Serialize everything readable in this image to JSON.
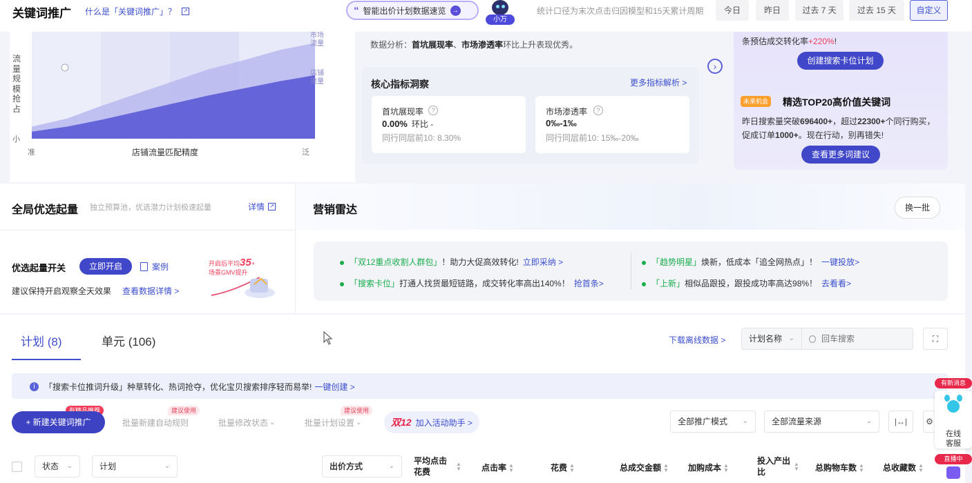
{
  "header": {
    "title": "关键词推广",
    "what_link": "什么是「关键词推广」？",
    "ai_pill_label": "智能出价计划数据速览",
    "mascot_label": "小万",
    "stat_note": "统计口径为末次点击归因模型和15天累计周期",
    "date_buttons": [
      {
        "label": "今日",
        "selected": false
      },
      {
        "label": "昨日",
        "selected": false
      },
      {
        "label": "过去 7 天",
        "selected": false
      },
      {
        "label": "过去 15 天",
        "selected": false
      },
      {
        "label": "自定义",
        "selected": true
      }
    ]
  },
  "traffic_chart": {
    "y_label": "流量规模抢占",
    "y_min_label": "小",
    "x_min_label": "准",
    "x_max_label": "泛",
    "x_label": "店铺流量匹配精度",
    "series_labels": [
      "市场流量",
      "店铺流量"
    ]
  },
  "chart_data": {
    "type": "area",
    "title": "",
    "xlabel": "店铺流量匹配精度",
    "ylabel": "流量规模抢占",
    "x_ticks": [
      "准",
      "泛"
    ],
    "y_ticks": [
      "小"
    ],
    "series": [
      {
        "name": "市场流量",
        "values": [
          0.12,
          0.2,
          0.33,
          0.45,
          0.57,
          0.69,
          0.78,
          0.88,
          0.95
        ]
      },
      {
        "name": "店铺流量",
        "values": [
          0.07,
          0.12,
          0.19,
          0.27,
          0.35,
          0.43,
          0.5,
          0.57,
          0.63
        ]
      }
    ],
    "ylim": [
      0,
      1
    ]
  },
  "analysis": {
    "prefix": "数据分析：",
    "item1": "首坑展现率",
    "sep": "、",
    "item2": "市场渗透率",
    "suffix": "环比上升表现优秀。"
  },
  "core_metrics": {
    "title": "核心指标洞察",
    "more_link": "更多指标解析 >",
    "items": [
      {
        "name": "首坑展现率",
        "value": "0.00%",
        "change": "环比 -",
        "peer": "同行同层前10: 8.30%"
      },
      {
        "name": "市场渗透率",
        "value": "0‰-1‰",
        "change": "",
        "peer": "同行同层前10: 15‰-20‰"
      }
    ]
  },
  "right_promo": {
    "top_text_prefix": "条预估成交转化率",
    "top_text_highlight": "+220%",
    "top_text_suffix": "!",
    "create_button": "创建搜索卡位计划",
    "badge": "未来机会",
    "title": "精选TOP20高价值关键词",
    "desc_1": "昨日搜索量突破",
    "num_1": "696400+",
    "desc_2": "，超过",
    "num_2": "22300+",
    "desc_3": "个同行购买，促成订单",
    "num_3": "1000+",
    "desc_4": "。现在行动，别再错失!",
    "more_button": "查看更多词建议"
  },
  "global_select": {
    "title": "全局优选起量",
    "subtitle": "独立预算池，优选潜力计划极速起量",
    "detail_link": "详情",
    "switch_label": "优选起量开关",
    "open_button": "立即开启",
    "case_link": "案例",
    "advice": "建议保持开启观察全天效果",
    "data_link": "查看数据详情 >",
    "illus_line1": "开启后平均",
    "illus_num": "35",
    "illus_line2": "场景GMV提升"
  },
  "radar": {
    "title": "营销雷达",
    "refresh_button": "换一批",
    "items": [
      {
        "tag": "「双12重点收割人群包」",
        "text": "！助力大促高效转化!",
        "link": "立即采纳 >"
      },
      {
        "tag": "「趋势明星」",
        "text": "焕新，低成本「追全网热点」！",
        "link": "一键投放>"
      },
      {
        "tag": "「搜索卡位」",
        "text": "打通人找货最短链路，成交转化率高出140%！",
        "link": "抢首条>"
      },
      {
        "tag": "「上新」",
        "text": "相似品跟投，跟投成功率高达98%！",
        "link": "去看看>"
      }
    ]
  },
  "tabs": [
    {
      "label": "计划 (8)",
      "active": true
    },
    {
      "label": "单元 (106)",
      "active": false
    }
  ],
  "toolbar": {
    "download_link": "下载离线数据 >",
    "filter_select": "计划名称",
    "search_placeholder": "回车搜索"
  },
  "tip": {
    "text": "「搜索卡位推词升级」种草转化、热词抢夺，优化宝贝搜索排序轻而易举!",
    "link": "一键创建 >"
  },
  "actions": {
    "new_button": "+ 新建关键词推广",
    "new_tag": "有精品推荐",
    "batch_rule": "批量新建自动规则",
    "batch_rule_tag": "建议使用",
    "batch_status": "批量修改状态",
    "batch_settings": "批量计划设置",
    "batch_settings_tag": "建议使用",
    "activity_logo": "双12",
    "activity_link": "加入活动助手 >",
    "mode_select": "全部推广模式",
    "source_select": "全部流量来源"
  },
  "table_headers": {
    "status": "状态",
    "plan": "计划",
    "bid_mode": "出价方式",
    "avg_cpc": "平均点击花费",
    "ctr": "点击率",
    "cost": "花费",
    "gmv": "总成交金额",
    "cart_cost": "加购成本",
    "roi": "投入产出比",
    "cart_count": "总购物车数",
    "fav_count": "总收藏数"
  },
  "service": {
    "new_msg": "有新消息",
    "label_line1": "在线",
    "label_line2": "客服",
    "live_tag": "直播中"
  }
}
